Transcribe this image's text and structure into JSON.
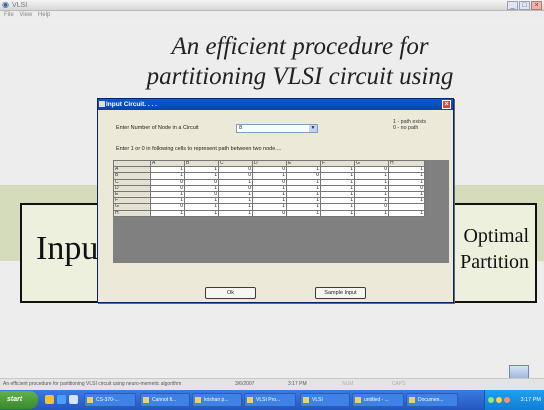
{
  "window": {
    "title": "VLSI",
    "menu": [
      "File",
      "View",
      "Help"
    ]
  },
  "slide": {
    "title_line1": "An efficient procedure for",
    "title_line2": "partitioning VLSI circuit using",
    "left_box": "Inpu",
    "right_box_line1": "Optimal",
    "right_box_line2": "Partition"
  },
  "dialog": {
    "title": "Input Circuit. . . .",
    "node_label": "Enter Number of Node in a Circuit",
    "node_value": "8",
    "legend_line1": "1 - path exists",
    "legend_line2": "0 - no path",
    "instruction": "Enter 1 or 0 in following cells to represent path between two node....",
    "ok_label": "Ok",
    "sample_label": "Sample Input",
    "grid": {
      "columns": [
        "A",
        "B",
        "C",
        "D",
        "E",
        "F",
        "G",
        "H"
      ],
      "rows": [
        {
          "label": "A",
          "cells": [
            "1",
            "1",
            "0",
            "0",
            "1",
            "1",
            "0",
            "1"
          ]
        },
        {
          "label": "B",
          "cells": [
            "1",
            "1",
            "0",
            "1",
            "0",
            "1",
            "1",
            "1"
          ]
        },
        {
          "label": "C",
          "cells": [
            "0",
            "0",
            "1",
            "0",
            "1",
            "1",
            "1",
            "1"
          ]
        },
        {
          "label": "D",
          "cells": [
            "0",
            "1",
            "0",
            "1",
            "1",
            "1",
            "1",
            "0"
          ]
        },
        {
          "label": "E",
          "cells": [
            "1",
            "0",
            "1",
            "1",
            "1",
            "1",
            "1",
            "1"
          ]
        },
        {
          "label": "F",
          "cells": [
            "1",
            "1",
            "1",
            "1",
            "1",
            "1",
            "1",
            "1"
          ]
        },
        {
          "label": "G",
          "cells": [
            "0",
            "1",
            "1",
            "1",
            "1",
            "1",
            "0",
            ""
          ]
        },
        {
          "label": "H",
          "cells": [
            "1",
            "1",
            "1",
            "0",
            "1",
            "1",
            "1",
            "1"
          ]
        }
      ]
    }
  },
  "status": {
    "text": "An efficient procedure for partitioning VLSI circuit using neuro-memetic algorithm",
    "date": "3/6/2007",
    "time": "3:17 PM",
    "num": "NUM",
    "caps": "CAPS"
  },
  "taskbar": {
    "start": "start",
    "tasks": [
      "CS-370-...",
      "Cannot fi...",
      "krishan p...",
      "VLSI Pro...",
      "VLSI",
      "untitled - ...",
      "Documen..."
    ],
    "clock": "3:17 PM"
  }
}
